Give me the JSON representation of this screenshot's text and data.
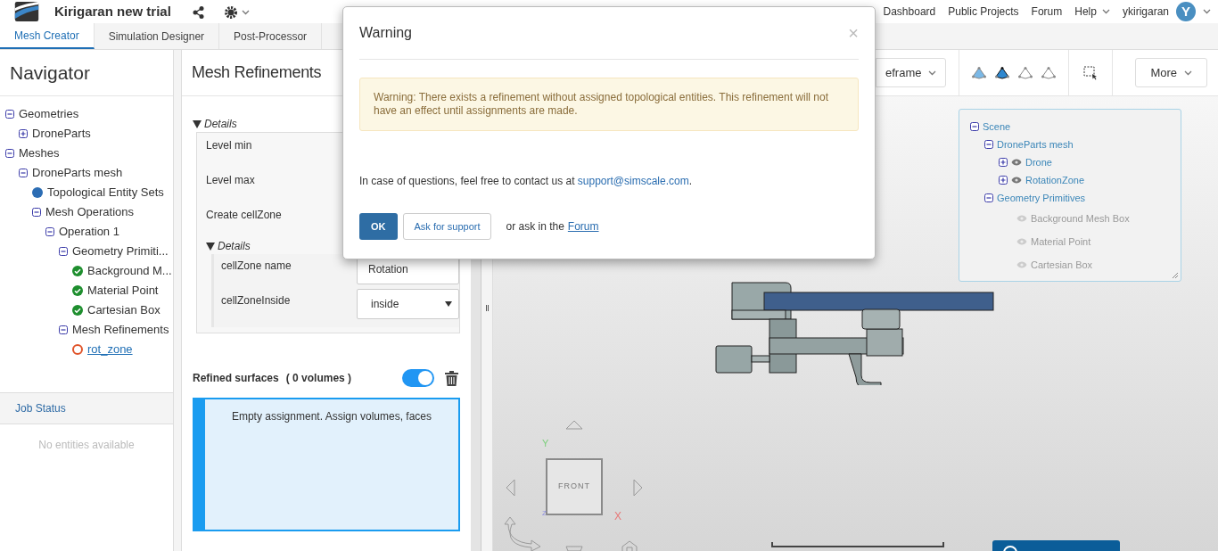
{
  "header": {
    "project_title": "Kirigaran new trial",
    "nav": [
      "Dashboard",
      "Public Projects",
      "Forum",
      "Help"
    ],
    "user": {
      "name": "ykirigaran",
      "avatar_letter": "Y"
    }
  },
  "tabs": [
    {
      "label": "Mesh Creator",
      "selected": true
    },
    {
      "label": "Simulation Designer",
      "selected": false
    },
    {
      "label": "Post-Processor",
      "selected": false
    }
  ],
  "navigator": {
    "title": "Navigator",
    "tree": [
      {
        "label": "Geometries",
        "kind": "toggle",
        "expanded": true,
        "selected": false,
        "children": [
          {
            "label": "DroneParts",
            "kind": "toggle",
            "expanded": false,
            "selected": false
          }
        ]
      },
      {
        "label": "Meshes",
        "kind": "toggle",
        "expanded": true,
        "selected": false,
        "children": [
          {
            "label": "DroneParts mesh",
            "kind": "toggle",
            "expanded": true,
            "selected": false,
            "children": [
              {
                "label": "Topological Entity Sets",
                "kind": "set",
                "selected": false
              },
              {
                "label": "Mesh Operations",
                "kind": "toggle",
                "expanded": true,
                "selected": false,
                "children": [
                  {
                    "label": "Operation 1",
                    "kind": "toggle",
                    "expanded": true,
                    "selected": false,
                    "children": [
                      {
                        "label": "Geometry Primiti...",
                        "kind": "toggle",
                        "expanded": true,
                        "selected": false,
                        "children": [
                          {
                            "label": "Background M...",
                            "kind": "valid",
                            "selected": false
                          },
                          {
                            "label": "Material Point",
                            "kind": "valid",
                            "selected": false
                          },
                          {
                            "label": "Cartesian Box",
                            "kind": "valid",
                            "selected": false
                          }
                        ]
                      },
                      {
                        "label": "Mesh Refinements",
                        "kind": "toggle",
                        "expanded": true,
                        "selected": false,
                        "children": [
                          {
                            "label": "rot_zone",
                            "kind": "invalid",
                            "selected": true
                          }
                        ]
                      }
                    ]
                  }
                ]
              }
            ]
          }
        ]
      }
    ]
  },
  "job_status": {
    "title": "Job Status",
    "empty_text": "No entities available"
  },
  "mesh_panel": {
    "title": "Mesh Refinements",
    "details_label": "Details",
    "fields": [
      "Level min",
      "Level max",
      "Create cellZone"
    ],
    "sub_details": {
      "label": "Details",
      "fields": [
        {
          "label": "cellZone name",
          "kind": "text",
          "value": "Rotation"
        },
        {
          "label": "cellZoneInside",
          "kind": "select",
          "value": "inside"
        }
      ]
    },
    "refined": {
      "label": "Refined surfaces",
      "count": "( 0 volumes )",
      "on": true
    },
    "assignment_text": "Empty assignment. Assign volumes, faces"
  },
  "viewport": {
    "view_button": "eframe",
    "more_button": "More",
    "scene_tree": [
      {
        "label": "Scene",
        "expanded": true,
        "children": [
          {
            "label": "DroneParts mesh",
            "expanded": true,
            "children": [
              {
                "label": "Drone",
                "expanded": false,
                "visible": true
              },
              {
                "label": "RotationZone",
                "expanded": false,
                "visible": true
              }
            ]
          },
          {
            "label": "Geometry Primitives",
            "expanded": true,
            "children": [
              {
                "label": "Background Mesh Box",
                "visible": false
              },
              {
                "label": "Material Point",
                "visible": false
              },
              {
                "label": "Cartesian Box",
                "visible": false
              }
            ]
          }
        ]
      }
    ],
    "cube": {
      "face": "FRONT",
      "axes": [
        "Y",
        "X",
        "Z"
      ]
    }
  },
  "dialog": {
    "title": "Warning",
    "close": "×",
    "warning": "Warning: There exists a refinement without assigned topological entities. This refinement will not have an effect until assignments are made.",
    "contact_prefix": "In case of questions, feel free to contact us at ",
    "contact_link": "support@simscale.com",
    "contact_suffix": ".",
    "buttons": [
      {
        "label": "OK",
        "kind": "primary"
      },
      {
        "label": "Ask for support",
        "kind": "default"
      }
    ],
    "forum_prefix": "or ask in the",
    "forum_link": "Forum"
  }
}
